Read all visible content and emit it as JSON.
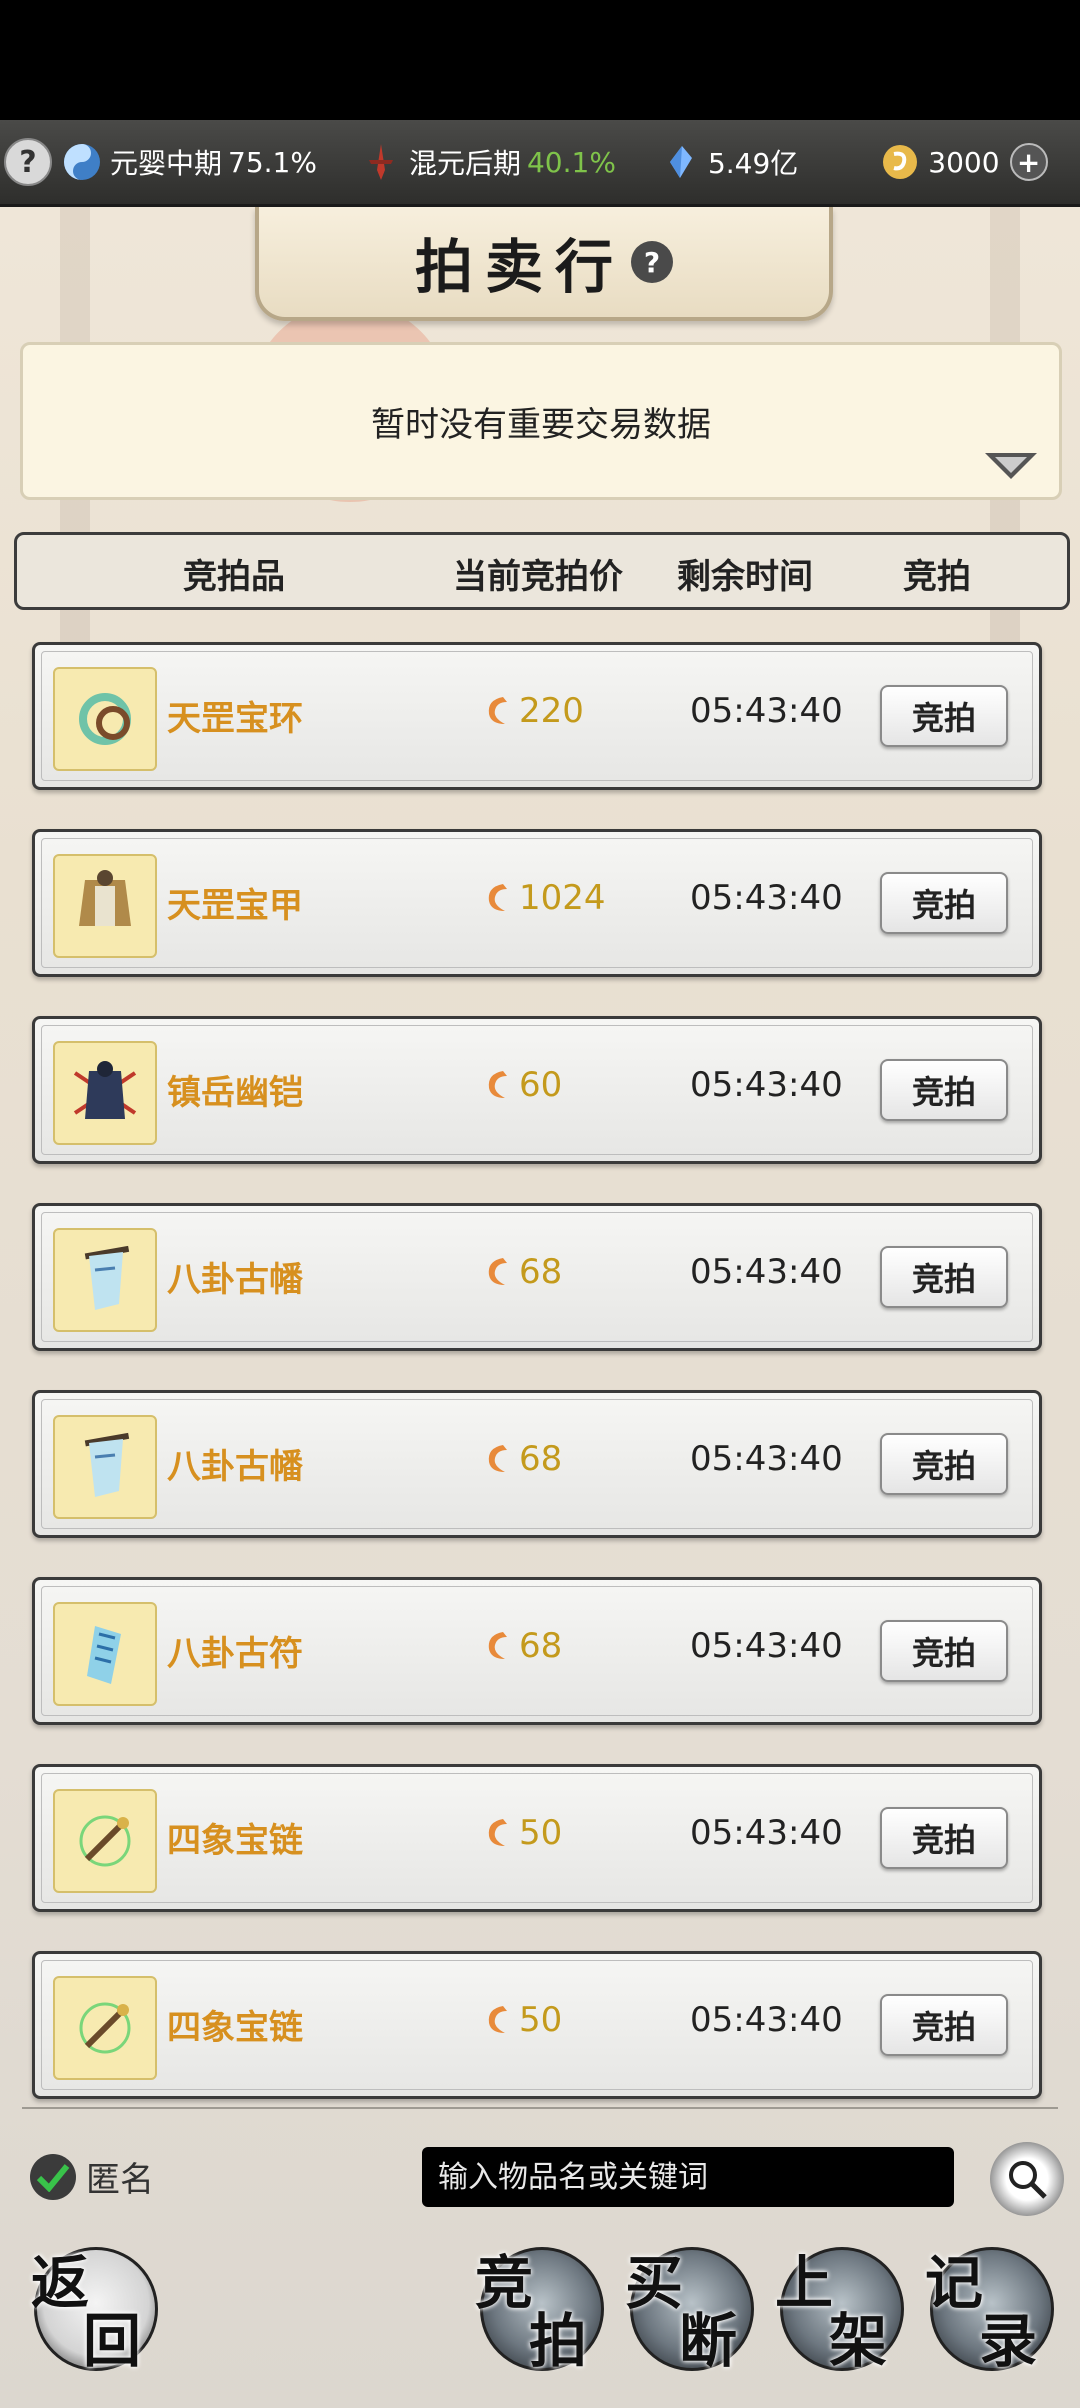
{
  "status_bar": {
    "help_glyph": "?",
    "cultivation": {
      "label": "元婴中期",
      "value": "75.1%"
    },
    "realm": {
      "label": "混元后期",
      "value": "40.1%"
    },
    "spirit_stone": {
      "value": "5.49亿"
    },
    "currency": {
      "value": "3000"
    },
    "add_glyph": "+"
  },
  "header": {
    "title": "拍卖行",
    "help_glyph": "?"
  },
  "notice": {
    "text": "暂时没有重要交易数据"
  },
  "table_headers": {
    "item": "竞拍品",
    "price": "当前竞拍价",
    "time": "剩余时间",
    "bid": "竞拍"
  },
  "items": [
    {
      "name": "天罡宝环",
      "price": "220",
      "time": "05:43:40",
      "bid_label": "竞拍",
      "icon": "ring-icon"
    },
    {
      "name": "天罡宝甲",
      "price": "1024",
      "time": "05:43:40",
      "bid_label": "竞拍",
      "icon": "armor-icon"
    },
    {
      "name": "镇岳幽铠",
      "price": "60",
      "time": "05:43:40",
      "bid_label": "竞拍",
      "icon": "dark-armor-icon"
    },
    {
      "name": "八卦古幡",
      "price": "68",
      "time": "05:43:40",
      "bid_label": "竞拍",
      "icon": "banner-icon"
    },
    {
      "name": "八卦古幡",
      "price": "68",
      "time": "05:43:40",
      "bid_label": "竞拍",
      "icon": "banner-icon"
    },
    {
      "name": "八卦古符",
      "price": "68",
      "time": "05:43:40",
      "bid_label": "竞拍",
      "icon": "talisman-icon"
    },
    {
      "name": "四象宝链",
      "price": "50",
      "time": "05:43:40",
      "bid_label": "竞拍",
      "icon": "chain-icon"
    },
    {
      "name": "四象宝链",
      "price": "50",
      "time": "05:43:40",
      "bid_label": "竞拍",
      "icon": "chain-icon"
    }
  ],
  "footer": {
    "anonymous_label": "匿名",
    "search_placeholder": "输入物品名或关键词",
    "buttons": {
      "back": [
        "返",
        "回"
      ],
      "auction": [
        "竞",
        "拍"
      ],
      "buyout": [
        "买",
        "断"
      ],
      "list": [
        "上",
        "架"
      ],
      "records": [
        "记",
        "录"
      ]
    }
  },
  "colors": {
    "item_name": "#d7901f",
    "price": "#c49a1c",
    "green_value": "#7fc34a"
  }
}
